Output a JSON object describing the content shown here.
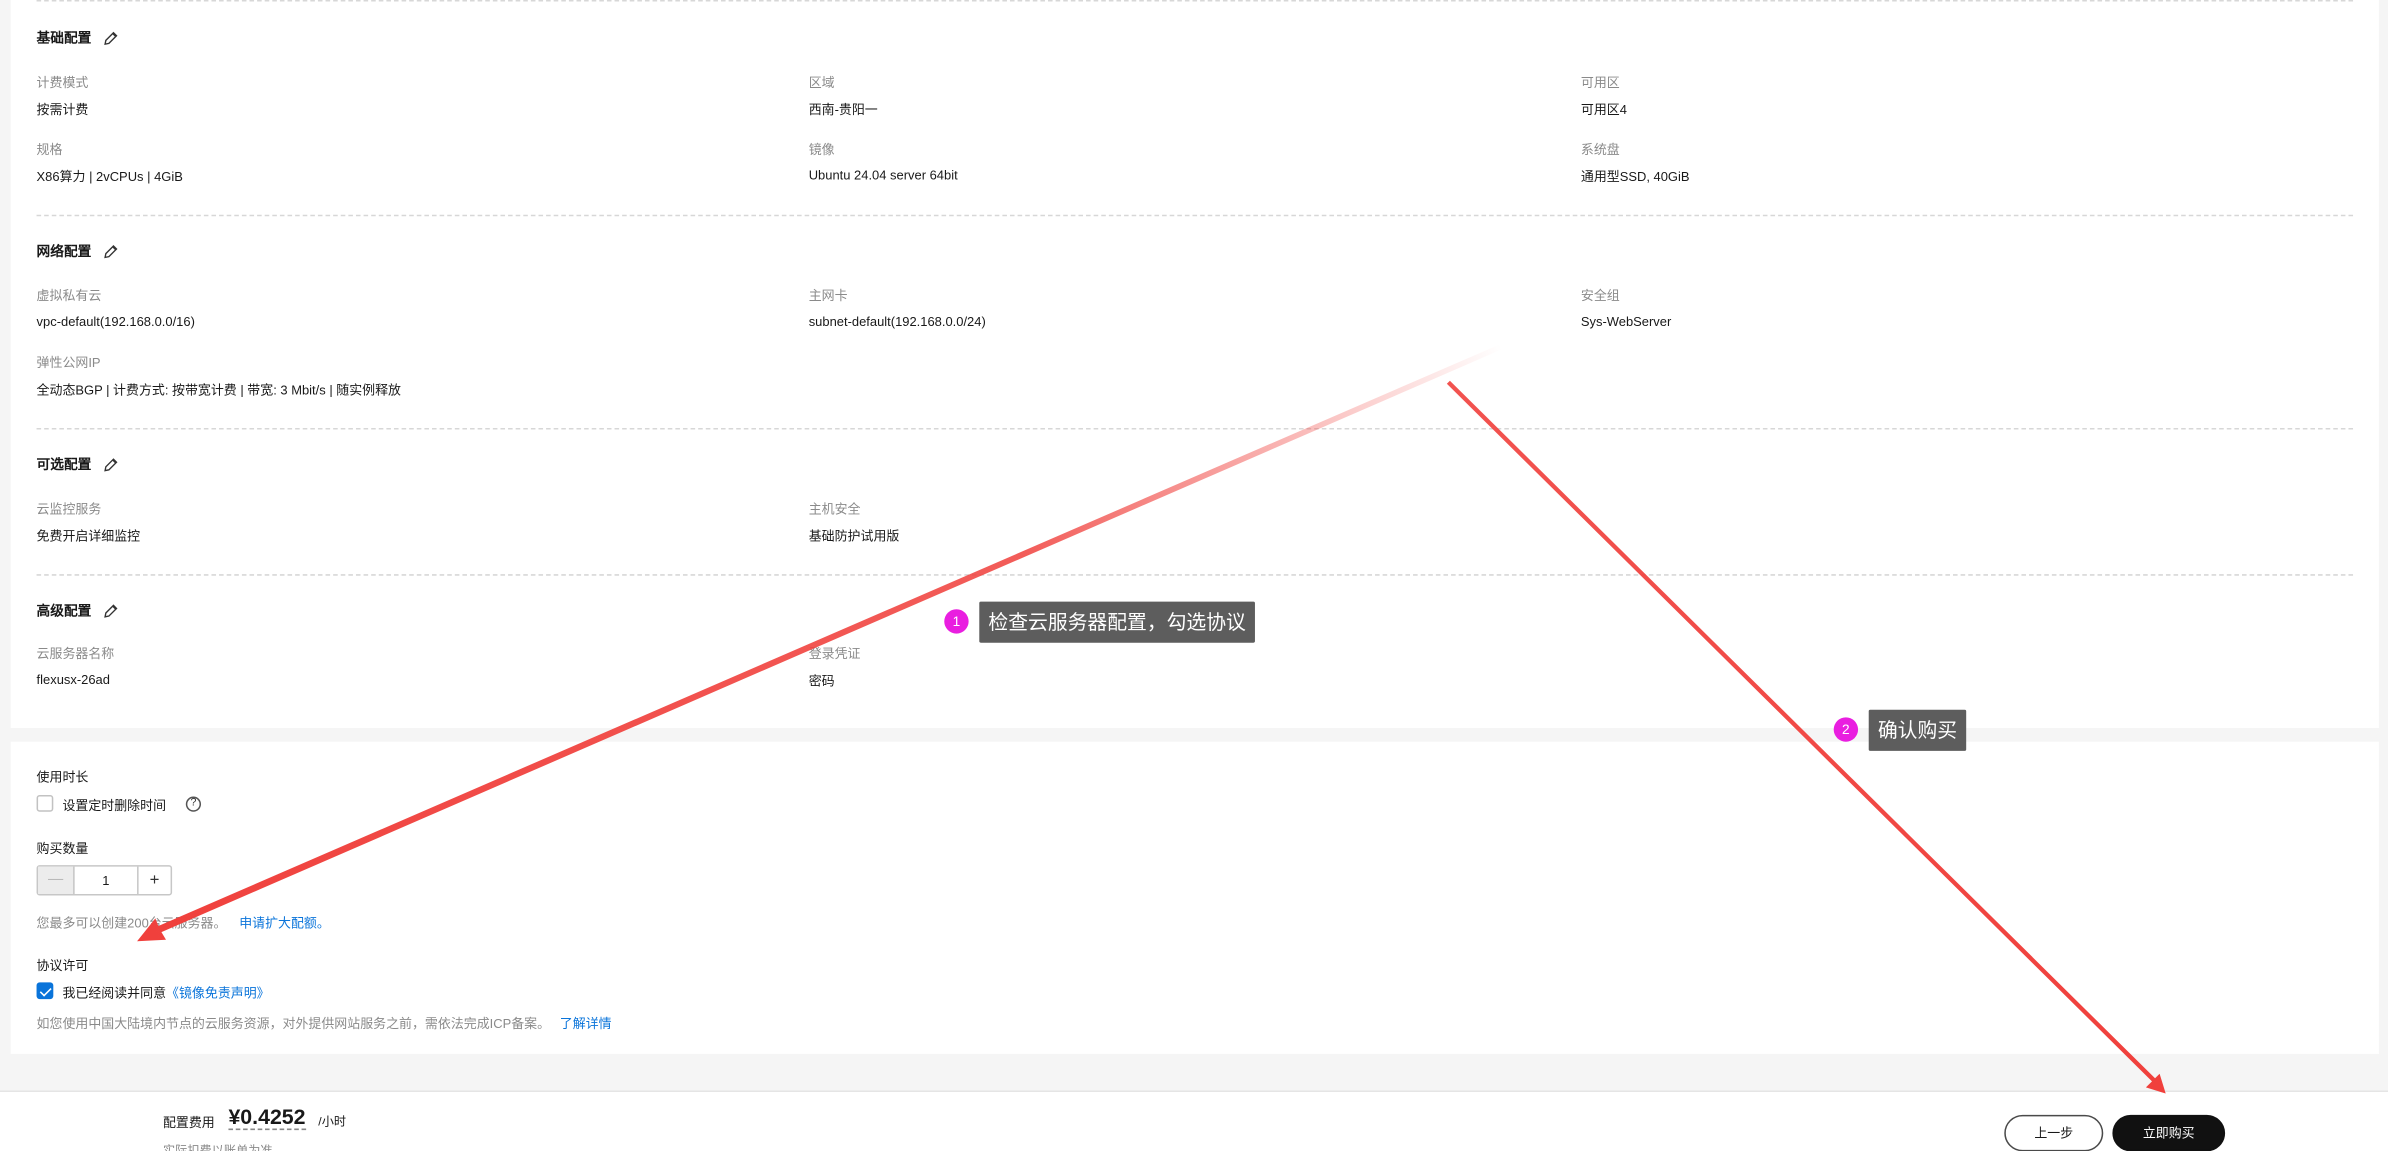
{
  "sections": {
    "basic": {
      "title": "基础配置",
      "fields": [
        {
          "label": "计费模式",
          "value": "按需计费"
        },
        {
          "label": "区域",
          "value": "西南-贵阳一"
        },
        {
          "label": "可用区",
          "value": "可用区4"
        },
        {
          "label": "规格",
          "value": "X86算力 | 2vCPUs | 4GiB"
        },
        {
          "label": "镜像",
          "value": "Ubuntu 24.04 server 64bit"
        },
        {
          "label": "系统盘",
          "value": "通用型SSD, 40GiB"
        }
      ]
    },
    "network": {
      "title": "网络配置",
      "fields": [
        {
          "label": "虚拟私有云",
          "value": "vpc-default(192.168.0.0/16)"
        },
        {
          "label": "主网卡",
          "value": "subnet-default(192.168.0.0/24)"
        },
        {
          "label": "安全组",
          "value": "Sys-WebServer"
        },
        {
          "label": "弹性公网IP",
          "value": "全动态BGP | 计费方式: 按带宽计费 | 带宽: 3 Mbit/s | 随实例释放"
        }
      ]
    },
    "optional": {
      "title": "可选配置",
      "fields": [
        {
          "label": "云监控服务",
          "value": "免费开启详细监控"
        },
        {
          "label": "主机安全",
          "value": "基础防护试用版"
        }
      ]
    },
    "advanced": {
      "title": "高级配置",
      "fields": [
        {
          "label": "云服务器名称",
          "value": "flexusx-26ad"
        },
        {
          "label": "登录凭证",
          "value": "密码"
        }
      ]
    }
  },
  "duration": {
    "title": "使用时长",
    "checkbox_label": "设置定时删除时间",
    "checked": false
  },
  "quantity": {
    "title": "购买数量",
    "value": "1",
    "minus": "—",
    "plus": "+",
    "note": "您最多可以创建200台云服务器。",
    "link": "申请扩大配额。"
  },
  "agreement": {
    "title": "协议许可",
    "checkbox_label": "我已经阅读并同意",
    "link": "《镜像免责声明》",
    "checked": true,
    "note": "如您使用中国大陆境内节点的云服务资源，对外提供网站服务之前，需依法完成ICP备案。",
    "note_link": "了解详情"
  },
  "footer": {
    "price_label": "配置费用",
    "price": "¥0.4252",
    "unit": "/小时",
    "price_note": "实际扣费以账单为准",
    "prev_button": "上一步",
    "buy_button": "立即购买"
  },
  "annotations": [
    {
      "number": "1",
      "text": "检查云服务器配置，勾选协议"
    },
    {
      "number": "2",
      "text": "确认购买"
    }
  ],
  "colors": {
    "accent": "#0a74da",
    "annotation_badge": "#e91ee0",
    "arrow": "#f0403c"
  }
}
